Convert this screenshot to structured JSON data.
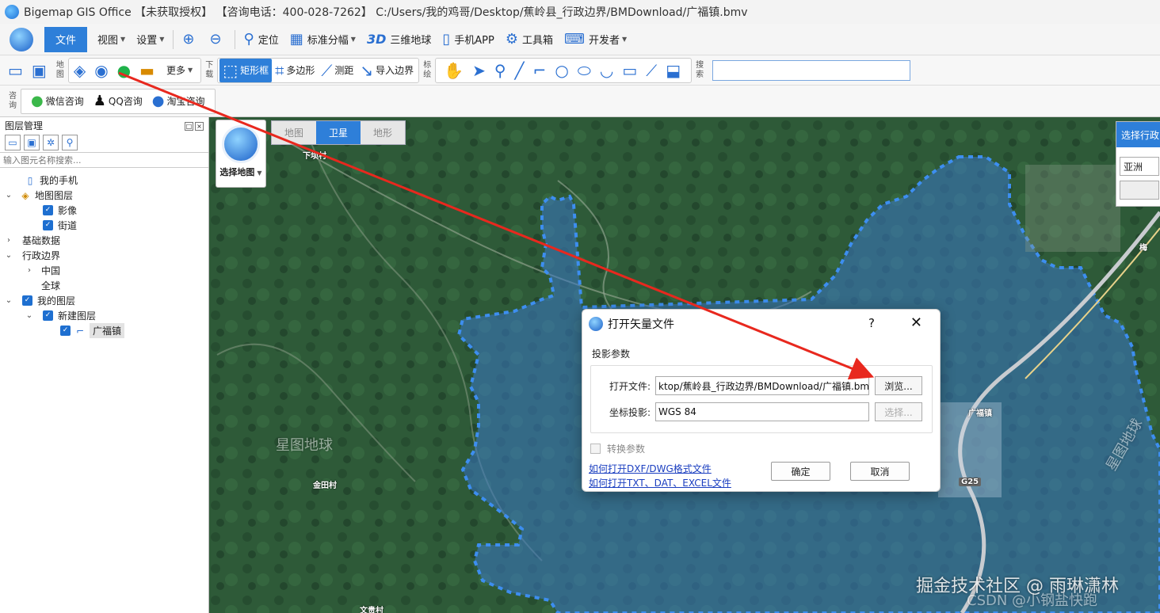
{
  "window": {
    "title": "Bigemap GIS Office 【未获取授权】 【咨询电话：400-028-7262】 C:/Users/我的鸡哥/Desktop/蕉岭县_行政边界/BMDownload/广福镇.bmv"
  },
  "menu": {
    "file": "文件",
    "view": "视图",
    "settings": "设置",
    "locate": "定位",
    "grid": "标准分幅",
    "three_d": "三维地球",
    "three_d_icon": "3D",
    "mobile": "手机APP",
    "tools": "工具箱",
    "dev": "开发者"
  },
  "toolbar": {
    "map_label": "地图",
    "more": "更多",
    "download_label": "下载",
    "rect": "矩形框",
    "polygon": "多边形",
    "measure": "测距",
    "import": "导入边界",
    "mark_label": "标绘",
    "search_label": "搜索"
  },
  "consult": {
    "label": "咨询",
    "wechat": "微信咨询",
    "qq": "QQ咨询",
    "taobao": "淘宝咨询"
  },
  "layers": {
    "title": "图层管理",
    "search_placeholder": "输入图元名称搜索...",
    "items": [
      {
        "label": "我的手机"
      },
      {
        "label": "地图图层"
      },
      {
        "label": "影像"
      },
      {
        "label": "街道"
      },
      {
        "label": "基础数据"
      },
      {
        "label": "行政边界"
      },
      {
        "label": "中国"
      },
      {
        "label": "全球"
      },
      {
        "label": "我的图层"
      },
      {
        "label": "新建图层"
      },
      {
        "label": "广福镇"
      }
    ]
  },
  "map": {
    "select_map": "选择地图",
    "tabs": [
      "地图",
      "卫星",
      "地形"
    ],
    "active_tab": "卫星",
    "region_header": "选择行政区",
    "region_value": "亚洲",
    "labels": [
      "下坝村",
      "金田村",
      "文贵村",
      "广福镇",
      "梅"
    ],
    "watermarks": [
      "星图地球",
      "星图地球"
    ],
    "road_badge": "G25"
  },
  "dialog": {
    "title": "打开矢量文件",
    "help": "?",
    "close": "✕",
    "group": "投影参数",
    "file_label": "打开文件:",
    "file_value": "ktop/蕉岭县_行政边界/BMDownload/广福镇.bmv",
    "browse": "浏览...",
    "proj_label": "坐标投影:",
    "proj_value": "WGS 84",
    "select": "选择...",
    "convert": "转换参数",
    "link1": "如何打开DXF/DWG格式文件",
    "link2": "如何打开TXT、DAT、EXCEL文件",
    "ok": "确定",
    "cancel": "取消"
  },
  "footer_watermark": "掘金技术社区 @ 雨琳潇林",
  "footer_watermark2": "CSDN @小钢盐快跑",
  "colors": {
    "accent": "#2e7fd9",
    "boundary": "#3d8ef0",
    "arrow": "#e8281e"
  }
}
